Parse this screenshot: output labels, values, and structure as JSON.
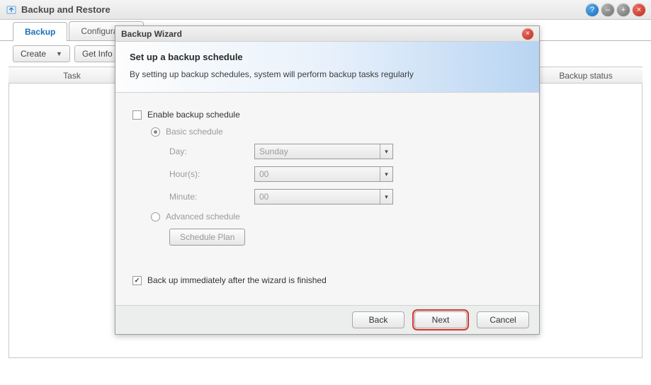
{
  "window": {
    "title": "Backup and Restore"
  },
  "tabs": {
    "backup": "Backup",
    "configuration": "Configuration"
  },
  "toolbar": {
    "create": "Create",
    "get_info": "Get Info"
  },
  "table": {
    "task": "Task",
    "status": "Backup status"
  },
  "wizard": {
    "title": "Backup Wizard",
    "heading": "Set up a backup schedule",
    "description": "By setting up backup schedules, system will perform backup tasks regularly",
    "enable_label": "Enable backup schedule",
    "basic_label": "Basic schedule",
    "day_label": "Day:",
    "day_value": "Sunday",
    "hour_label": "Hour(s):",
    "hour_value": "00",
    "minute_label": "Minute:",
    "minute_value": "00",
    "advanced_label": "Advanced schedule",
    "schedule_plan_btn": "Schedule Plan",
    "backup_now_label": "Back up immediately after the wizard is finished",
    "back_btn": "Back",
    "next_btn": "Next",
    "cancel_btn": "Cancel"
  }
}
